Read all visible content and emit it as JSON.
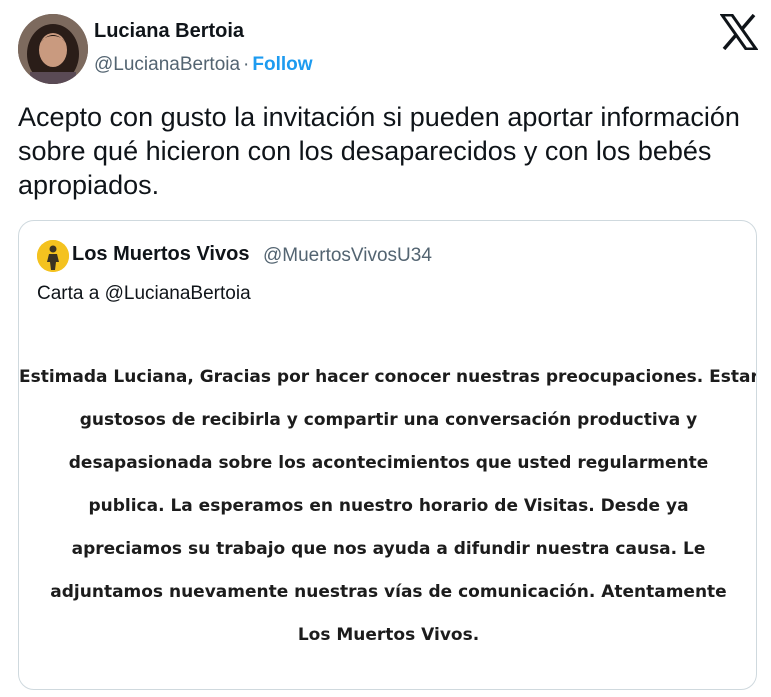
{
  "author": {
    "name": "Luciana Bertoia",
    "handle": "@LucianaBertoia",
    "separator": "·",
    "follow_label": "Follow"
  },
  "icons": {
    "platform_logo": "x-logo-icon",
    "avatar": "avatar",
    "quote_avatar": "yellow-avatar"
  },
  "colors": {
    "follow": "#1d9bf0",
    "muted": "#536471",
    "border": "#cfd9de",
    "text": "#0f1419",
    "quote_avatar_bg": "#f4c21f"
  },
  "tweet": {
    "text": "Acepto con gusto la invitación si pueden aportar información sobre qué hicieron con los desaparecidos y con los bebés apropiados."
  },
  "quote": {
    "name": "Los Muertos Vivos",
    "handle": "@MuertosVivosU34",
    "text": "Carta a @LucianaBertoia",
    "letter_lines": [
      "Estimada Luciana, Gracias por hacer conocer nuestras preocupaciones. Estaremos",
      "gustosos de recibirla y compartir una conversación productiva y",
      "desapasionada sobre los acontecimientos que usted regularmente",
      "publica. La esperamos en nuestro horario de Visitas. Desde ya",
      "apreciamos su trabajo que nos ayuda a difundir nuestra causa. Le",
      "adjuntamos nuevamente nuestras vías de comunicación. Atentamente",
      "Los Muertos Vivos."
    ]
  }
}
